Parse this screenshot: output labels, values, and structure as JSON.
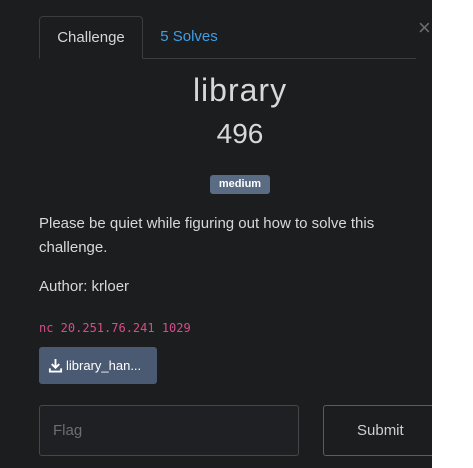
{
  "tabs": {
    "challenge_label": "Challenge",
    "solves_label": "5 Solves"
  },
  "challenge": {
    "name": "library",
    "points": "496",
    "difficulty": "medium",
    "description": "Please be quiet while figuring out how to solve this challenge.",
    "author": "Author: krloer",
    "connection": "nc 20.251.76.241 1029",
    "file_label": "library_han..."
  },
  "form": {
    "flag_placeholder": "Flag",
    "submit_label": "Submit"
  },
  "icons": {
    "close": "close-icon",
    "download": "download-icon"
  },
  "colors": {
    "background": "#1c1d1f",
    "link": "#3f9ee6",
    "badge": "#5a6b84",
    "connection_text": "#d64d8a",
    "file_button": "#4a5a72"
  }
}
